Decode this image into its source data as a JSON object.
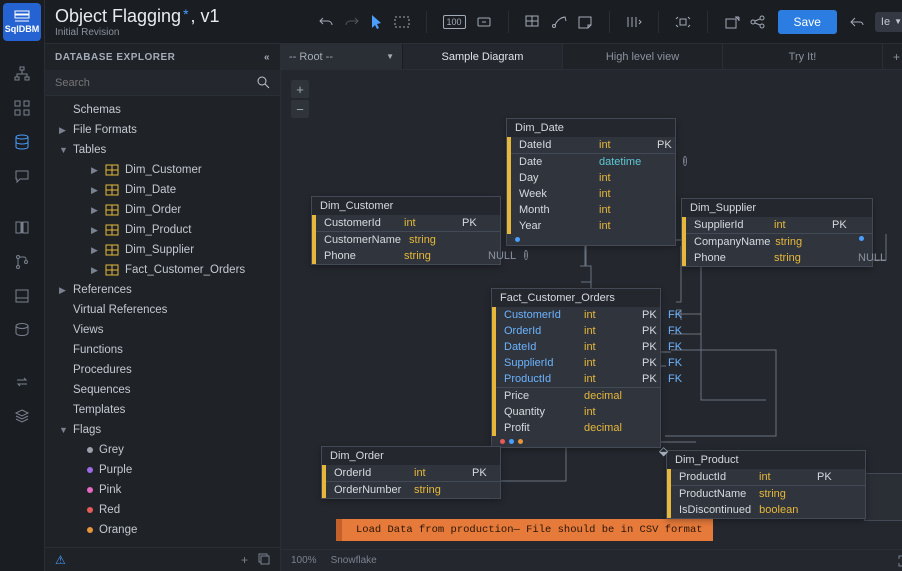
{
  "brand": "SqlDBM",
  "title_prefix": "Object Flagging",
  "title_suffix": ", v1",
  "subtitle": "Initial Revision",
  "toolbar": {
    "save": "Save",
    "lang": "Ie",
    "percent_label": "100"
  },
  "explorer": {
    "header": "DATABASE EXPLORER",
    "search_placeholder": "Search",
    "nodes": {
      "schemas": "Schemas",
      "file_formats": "File Formats",
      "tables": "Tables",
      "tables_items": [
        "Dim_Customer",
        "Dim_Date",
        "Dim_Order",
        "Dim_Product",
        "Dim_Supplier",
        "Fact_Customer_Orders"
      ],
      "references": "References",
      "virtual_refs": "Virtual References",
      "views": "Views",
      "functions": "Functions",
      "procedures": "Procedures",
      "sequences": "Sequences",
      "templates": "Templates",
      "flags": "Flags",
      "flags_items": [
        {
          "label": "Grey",
          "color": "#9aa1ab"
        },
        {
          "label": "Purple",
          "color": "#9b6be6"
        },
        {
          "label": "Pink",
          "color": "#e668c1"
        },
        {
          "label": "Red",
          "color": "#e65a5a"
        },
        {
          "label": "Orange",
          "color": "#e6953a"
        }
      ]
    }
  },
  "tabs": {
    "root": "-- Root --",
    "items": [
      "Sample Diagram",
      "High level view",
      "Try It!"
    ]
  },
  "note_text": "Load Data from production— File should be in CSV format",
  "status": {
    "zoom": "100%",
    "engine": "Snowflake"
  },
  "entities": {
    "dim_date": {
      "name": "Dim_Date",
      "cols": [
        {
          "n": "DateId",
          "t": "int",
          "k": "PK"
        },
        {
          "n": "Date",
          "t": "datetime",
          "dt": true,
          "info": true,
          "sep": true
        },
        {
          "n": "Day",
          "t": "int"
        },
        {
          "n": "Week",
          "t": "int"
        },
        {
          "n": "Month",
          "t": "int"
        },
        {
          "n": "Year",
          "t": "int"
        }
      ]
    },
    "dim_customer": {
      "name": "Dim_Customer",
      "cols": [
        {
          "n": "CustomerId",
          "t": "int",
          "k": "PK"
        },
        {
          "n": "CustomerName",
          "t": "string",
          "sep": true
        },
        {
          "n": "Phone",
          "t": "string",
          "x": "NULL",
          "info": true
        }
      ]
    },
    "dim_supplier": {
      "name": "Dim_Supplier",
      "cols": [
        {
          "n": "SupplierId",
          "t": "int",
          "k": "PK"
        },
        {
          "n": "CompanyName",
          "t": "string",
          "sep": true,
          "bluedot": true
        },
        {
          "n": "Phone",
          "t": "string",
          "x": "NULL"
        }
      ]
    },
    "fact": {
      "name": "Fact_Customer_Orders",
      "cols": [
        {
          "n": "CustomerId",
          "t": "int",
          "k": "PK",
          "fk": "FK",
          "fkname": true
        },
        {
          "n": "OrderId",
          "t": "int",
          "k": "PK",
          "fk": "FK",
          "fkname": true
        },
        {
          "n": "DateId",
          "t": "int",
          "k": "PK",
          "fk": "FK",
          "fkname": true
        },
        {
          "n": "SupplierId",
          "t": "int",
          "k": "PK",
          "fk": "FK",
          "fkname": true
        },
        {
          "n": "ProductId",
          "t": "int",
          "k": "PK",
          "fk": "FK",
          "fkname": true
        },
        {
          "n": "Price",
          "t": "decimal",
          "sep": true
        },
        {
          "n": "Quantity",
          "t": "int"
        },
        {
          "n": "Profit",
          "t": "decimal"
        }
      ]
    },
    "dim_order": {
      "name": "Dim_Order",
      "cols": [
        {
          "n": "OrderId",
          "t": "int",
          "k": "PK"
        },
        {
          "n": "OrderNumber",
          "t": "string",
          "sep": true
        }
      ]
    },
    "dim_product": {
      "name": "Dim_Product",
      "cols": [
        {
          "n": "ProductId",
          "t": "int",
          "k": "PK"
        },
        {
          "n": "ProductName",
          "t": "string",
          "sep": true
        },
        {
          "n": "IsDiscontinued",
          "t": "boolean"
        }
      ]
    }
  }
}
